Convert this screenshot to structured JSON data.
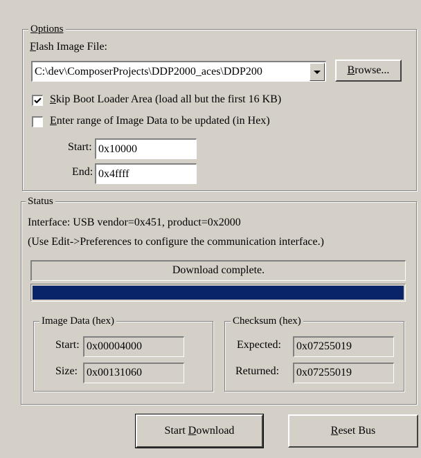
{
  "options": {
    "legend": "Options",
    "flash_label_accel": "F",
    "flash_label_rest": "lash Image File:",
    "flash_path": "C:\\dev\\ComposerProjects\\DDP2000_aces\\DDP200",
    "browse_accel": "B",
    "browse_rest": "rowse...",
    "skip_boot": {
      "accel": "S",
      "rest": "kip Boot Loader Area (load all but the first 16 KB)",
      "checked": true
    },
    "enter_range": {
      "accel": "E",
      "rest": "nter range of Image Data to be updated (in Hex)",
      "checked": false
    },
    "start_label": "Start:",
    "start_value": "0x10000",
    "end_label": "End:",
    "end_value": "0x4ffff"
  },
  "status": {
    "legend": "Status",
    "interface_line": "Interface:  USB vendor=0x451, product=0x2000",
    "hint_line": "(Use Edit->Preferences to configure the communication interface.)",
    "message": "Download complete.",
    "progress_fraction": 1.0,
    "image_data": {
      "legend": "Image Data (hex)",
      "start_label": "Start:",
      "start_value": "0x00004000",
      "size_label": "Size:",
      "size_value": "0x00131060"
    },
    "checksum": {
      "legend": "Checksum (hex)",
      "expected_label": "Expected:",
      "expected_value": "0x07255019",
      "returned_label": "Returned:",
      "returned_value": "0x07255019"
    }
  },
  "buttons": {
    "start_download_pre": "Start ",
    "start_download_accel": "D",
    "start_download_rest": "ownload",
    "reset_bus_accel": "R",
    "reset_bus_rest": "eset Bus"
  },
  "colors": {
    "face": "#d4d0c8",
    "progress": "#0a246a"
  }
}
